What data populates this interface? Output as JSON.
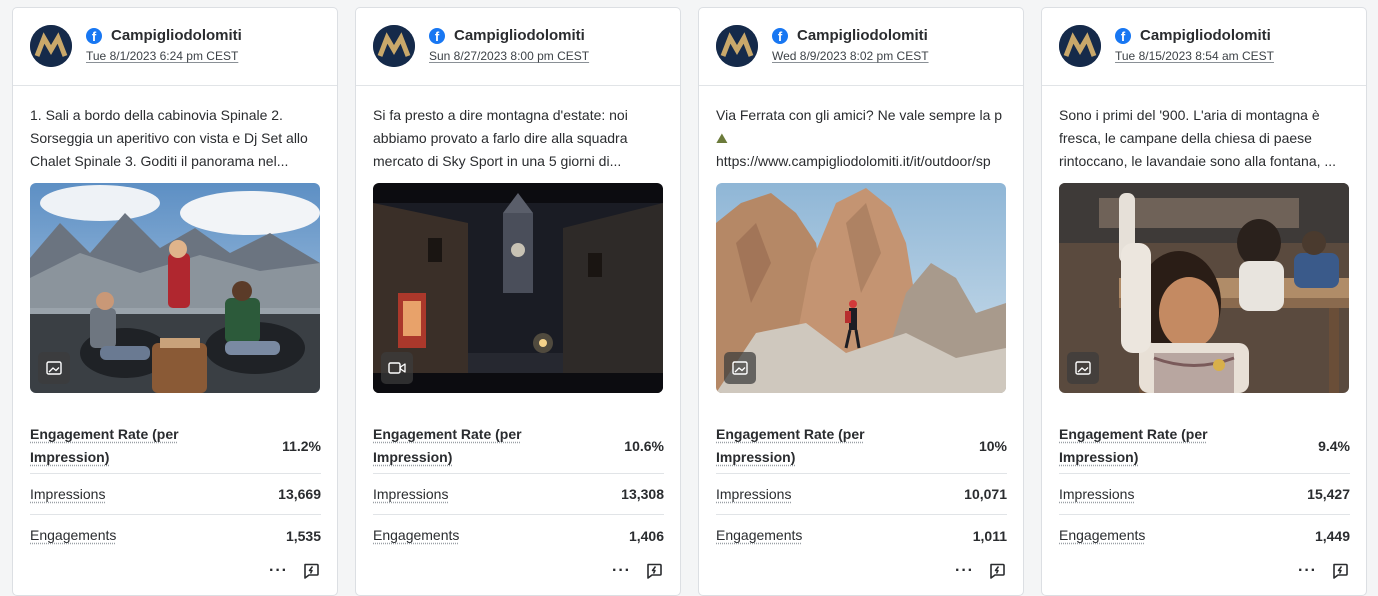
{
  "cards": [
    {
      "profile_name": "Campigliodolomiti",
      "date": "Tue 8/1/2023 6:24 pm CEST",
      "text": "1. Sali a bordo della cabinovia Spinale 2. Sorseggia un aperitivo con vista e Dj Set allo Chalet Spinale 3. Goditi il panorama nel...",
      "media_type": "image-icon",
      "metrics": [
        {
          "label": "Engagement Rate (per Impression)",
          "value": "11.2%"
        },
        {
          "label": "Impressions",
          "value": "13,669"
        },
        {
          "label": "Engagements",
          "value": "1,535"
        }
      ],
      "more_label": "···"
    },
    {
      "profile_name": "Campigliodolomiti",
      "date": "Sun 8/27/2023 8:00 pm CEST",
      "text": "Si fa presto a dire montagna d'estate: noi abbiamo provato a farlo dire alla squadra mercato di Sky Sport in una 5 giorni di...",
      "media_type": "video-icon",
      "metrics": [
        {
          "label": "Engagement Rate (per Impression)",
          "value": "10.6%"
        },
        {
          "label": "Impressions",
          "value": "13,308"
        },
        {
          "label": "Engagements",
          "value": "1,406"
        }
      ],
      "more_label": "···"
    },
    {
      "profile_name": "Campigliodolomiti",
      "date": "Wed 8/9/2023 8:02 pm CEST",
      "text_line1": "Via Ferrata con gli amici? Ne vale sempre la p",
      "text_line2": "⛰",
      "text_line3": "https://www.campigliodolomiti.it/it/outdoor/sp",
      "media_type": "image-icon",
      "metrics": [
        {
          "label": "Engagement Rate (per Impression)",
          "value": "10%"
        },
        {
          "label": "Impressions",
          "value": "10,071"
        },
        {
          "label": "Engagements",
          "value": "1,011"
        }
      ],
      "more_label": "···"
    },
    {
      "profile_name": "Campigliodolomiti",
      "date": "Tue 8/15/2023 8:54 am CEST",
      "text": "Sono i primi del '900. L'aria di montagna è fresca, le campane della chiesa di paese rintoccano, le lavandaie sono alla fontana, ...",
      "media_type": "image-icon",
      "metrics": [
        {
          "label": "Engagement Rate (per Impression)",
          "value": "9.4%"
        },
        {
          "label": "Impressions",
          "value": "15,427"
        },
        {
          "label": "Engagements",
          "value": "1,449"
        }
      ],
      "more_label": "···"
    }
  ],
  "colors": {
    "facebook": "#1877f2",
    "avatar_bg": "#152a4a",
    "avatar_logo": "#c9a86a"
  }
}
